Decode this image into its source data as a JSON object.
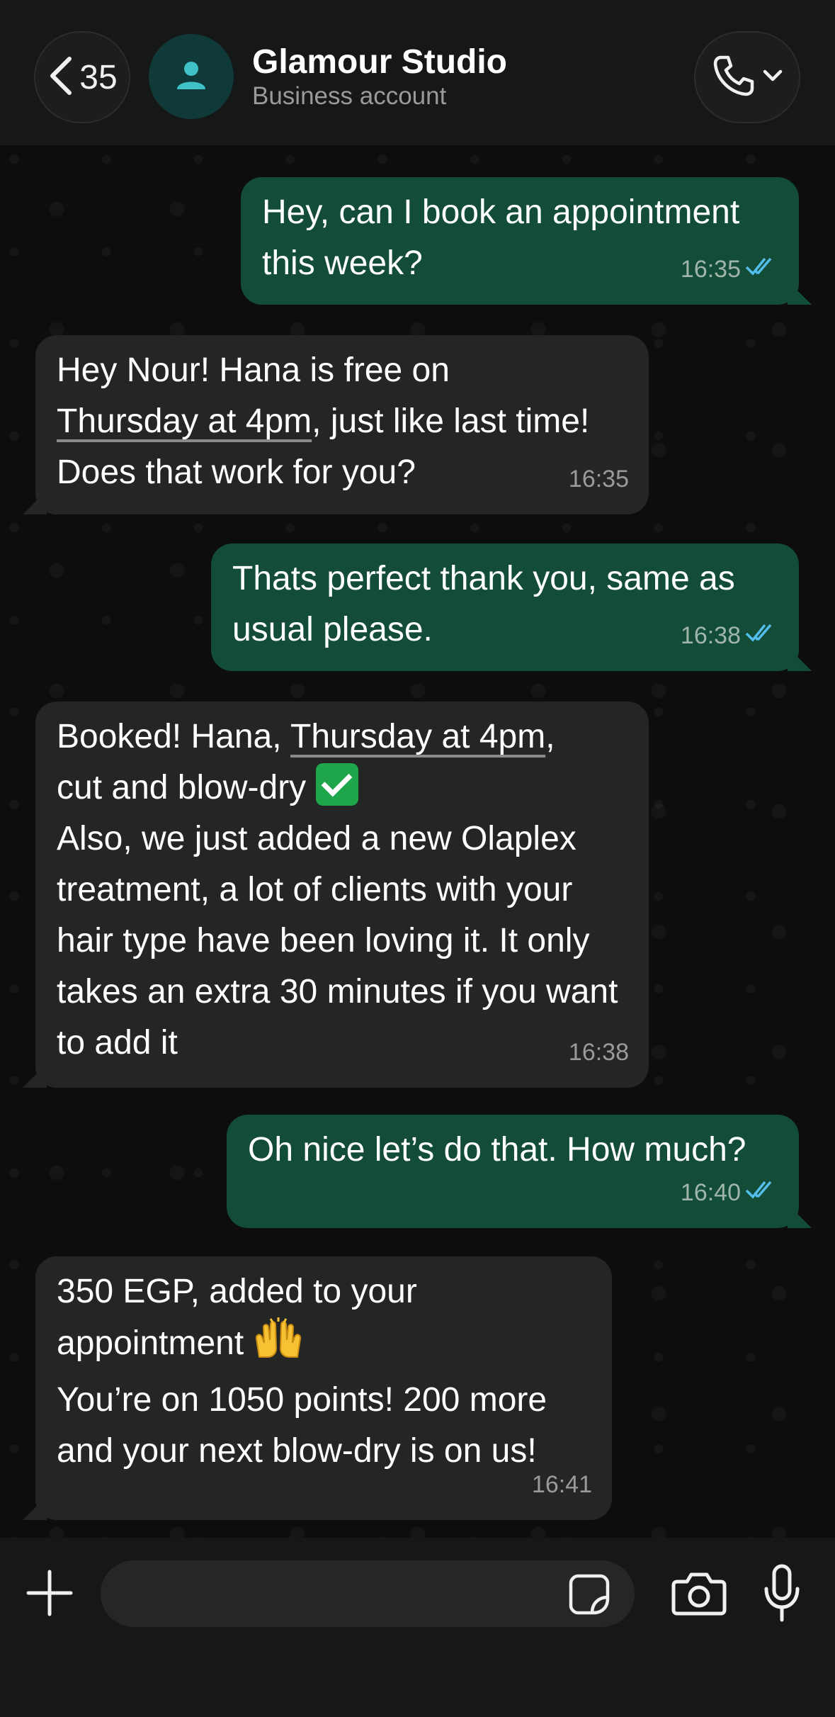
{
  "header": {
    "back_count": "35",
    "contact_name": "Glamour Studio",
    "contact_status": "Business account"
  },
  "messages": [
    {
      "dir": "out",
      "text": "Hey, can I book an appointment this week?",
      "time": "16:35",
      "read": true
    },
    {
      "dir": "in",
      "text_a": "Hey Nour! Hana is free on",
      "link": "Thursday at 4pm",
      "text_b": ", just like last time! Does that work for you?",
      "time": "16:35"
    },
    {
      "dir": "out",
      "text": "Thats perfect thank you, same as usual please.",
      "time": "16:38",
      "read": true
    },
    {
      "dir": "in",
      "text_a": "Booked! Hana,",
      "link": "Thursday at 4pm",
      "text_b": ",",
      "text_c": "cut and blow-dry",
      "text_d": "Also, we just added a new Olaplex treatment, a lot of clients with your hair type have been loving it. It only takes an extra 30 minutes if you want to add it",
      "time": "16:38"
    },
    {
      "dir": "out",
      "text": "Oh nice let’s do that. How much?",
      "time": "16:40",
      "read": true
    },
    {
      "dir": "in",
      "text_a": "350 EGP, added to your appointment",
      "text_b": "You’re on 1050 points! 200 more and your next blow-dry is on us!",
      "time": "16:41"
    }
  ],
  "composer": {
    "placeholder": ""
  },
  "colors": {
    "outgoing_bubble": "#134d37",
    "incoming_bubble": "#242626",
    "read_ticks": "#53bdeb"
  }
}
